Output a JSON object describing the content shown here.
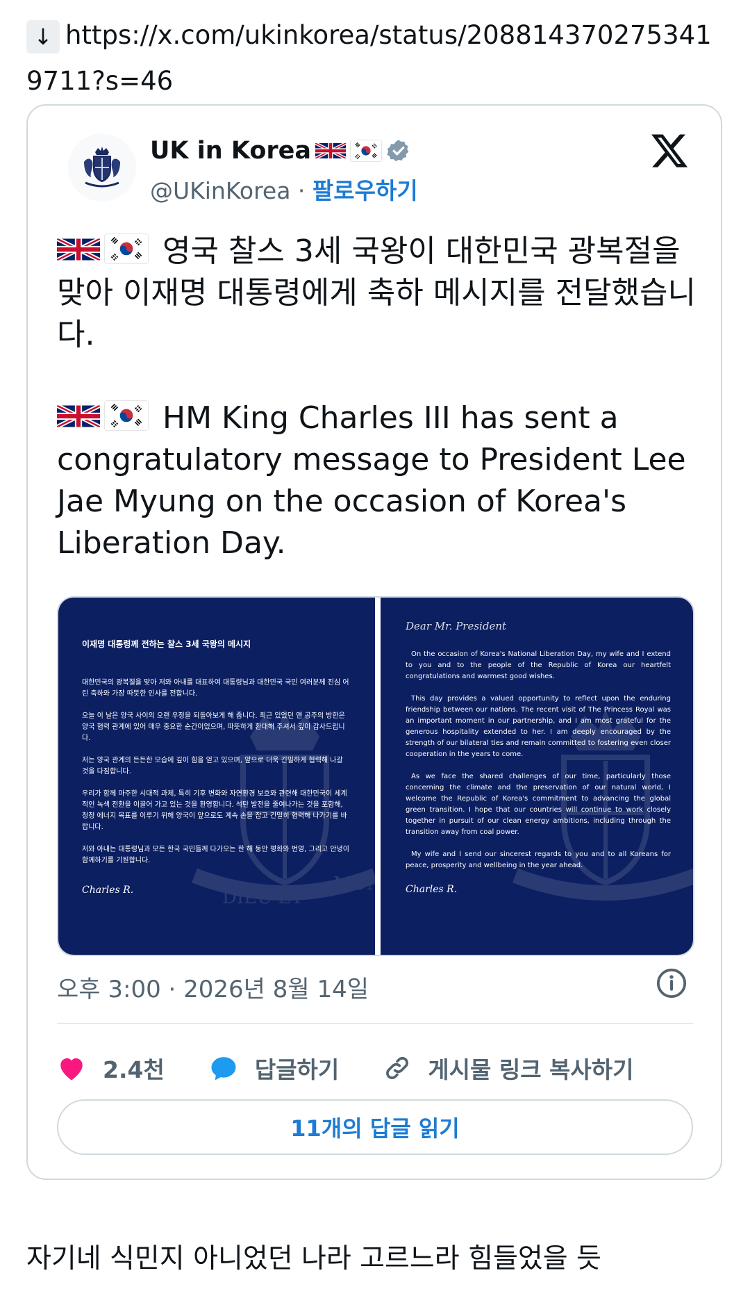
{
  "link": {
    "arrow": "↓",
    "url": "https://x.com/ukinkorea/status/2088143702753419711?s=46"
  },
  "tweet": {
    "account_name": "UK in Korea",
    "handle": "@UKinKorea",
    "separator": " · ",
    "follow_label": "팔로우하기",
    "text_ko": "영국 찰스 3세 국왕이 대한민국 광복절을 맞아 이재명 대통령에게 축하 메시지를 전달했습니다.",
    "text_en": "HM King Charles III has sent a congratulatory message to President Lee Jae Myung on the occasion of Korea's Liberation Day.",
    "timestamp": "오후 3:00 · 2026년 8월 14일",
    "likes": "2.4천",
    "reply_label": "답글하기",
    "copy_link_label": "게시물 링크 복사하기",
    "read_replies_label": "11개의 답글 읽기"
  },
  "letter_ko": {
    "title": "이재명 대통령께 전하는 찰스 3세 국왕의 메시지",
    "paragraphs": [
      "대한민국의 광복절을 맞아 저와 아내를 대표하여 대통령님과 대한민국 국민 여러분께 진심 어린 축하와 가장 따뜻한 인사를 전합니다.",
      "오늘 이 날은 양국 사이의 오랜 우정을 되돌아보게 해 줍니다. 최근 있었던 앤 공주의 방한은 양국 협력 관계에 있어 매우 중요한 순간이었으며, 따뜻하게 환대해 주셔서 깊이 감사드립니다.",
      "저는 양국 관계의 든든한 모습에 깊이 힘을 얻고 있으며, 앞으로 더욱 긴밀하게 협력해 나갈 것을 다짐합니다.",
      "우리가 함께 마주한 시대적 과제, 특히 기후 변화와 자연환경 보호와 관련해 대한민국이 세계적인 녹색 전환을 이끌어 가고 있는 것을 환영합니다. 석탄 발전을 줄여나가는 것을 포함해, 청정 에너지 목표를 이루기 위해 양국이 앞으로도 계속 손을 잡고 긴밀히 협력해 나가기를 바랍니다.",
      "저와 아내는 대통령님과 모든 한국 국민들께 다가오는 한 해 동안 평화와 번영, 그리고 안녕이 함께하기를 기원합니다."
    ],
    "signature": "Charles R."
  },
  "letter_en": {
    "salutation": "Dear Mr. President",
    "paragraphs": [
      "On the occasion of Korea's National Liberation Day, my wife and I extend to you and to the people of the Republic of Korea our heartfelt congratulations and warmest good wishes.",
      "This day provides a valued opportunity to reflect upon the enduring friendship between our nations. The recent visit of The Princess Royal was an important moment in our partnership, and I am most grateful for the generous hospitality extended to her. I am deeply encouraged by the strength of our bilateral ties and remain committed to fostering even closer cooperation in the years to come.",
      "As we face the shared challenges of our time, particularly those concerning the climate and the preservation of our natural world, I welcome the Republic of Korea's commitment to advancing the global green transition. I hope that our countries will continue to work closely together in pursuit of our clean energy ambitions, including through the transition away from coal power.",
      "My wife and I send our sincerest regards to you and to all Koreans for peace, prosperity and wellbeing in the year ahead."
    ],
    "signature": "Charles R."
  },
  "crest_motto": [
    "DIEU ET",
    "MON DR"
  ],
  "comment": "자기네 식민지 아니었던 나라 고르느라 힘들었을 듯",
  "icons": [
    "arrow-down-icon",
    "royal-crest-icon",
    "uk-flag-icon",
    "korea-flag-icon",
    "verified-badge-icon",
    "x-logo-icon",
    "info-icon",
    "heart-icon",
    "reply-bubble-icon",
    "link-icon"
  ],
  "colors": {
    "link_blue": "#1d7bd3",
    "heart": "#f91880",
    "reply_blue": "#1d9bf0",
    "letter_navy": "#0c1f61",
    "verified_gray": "#829aab"
  }
}
